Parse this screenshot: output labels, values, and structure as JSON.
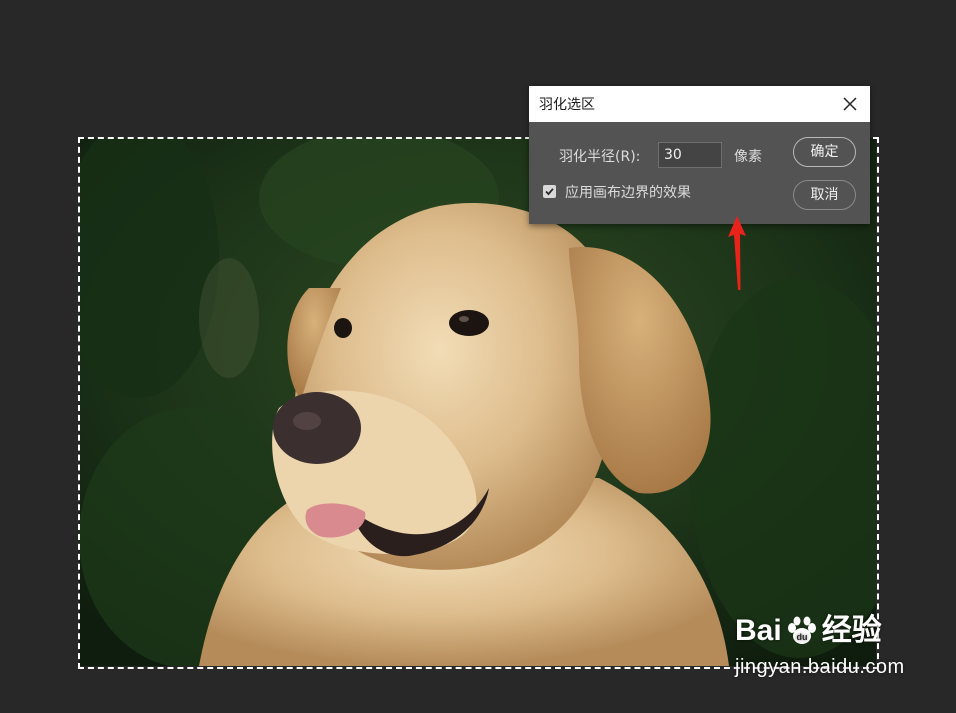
{
  "dialog": {
    "title": "羽化选区",
    "radius_label": "羽化半径(R):",
    "radius_value": "30",
    "radius_unit": "像素",
    "ok_label": "确定",
    "cancel_label": "取消",
    "checkbox_label": "应用画布边界的效果",
    "checkbox_checked": true
  },
  "watermark": {
    "brand_left": "Bai",
    "brand_right": "经验",
    "url": "jingyan.baidu.com"
  },
  "colors": {
    "canvas_bg": "#282828",
    "dialog_bg": "#535353",
    "title_bg": "#ffffff",
    "annotation_arrow": "#e8231a"
  },
  "icons": {
    "close": "close-icon",
    "check": "checkmark-icon",
    "arrow": "red-up-arrow-icon",
    "paw": "baidu-paw-icon"
  }
}
